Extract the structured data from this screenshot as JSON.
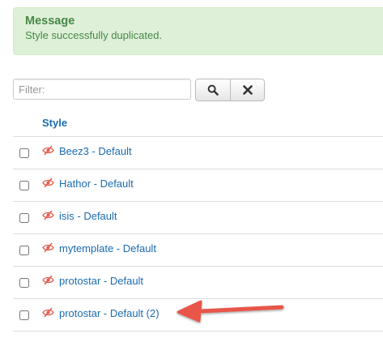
{
  "message": {
    "heading": "Message",
    "text": "Style successfully duplicated."
  },
  "filter": {
    "placeholder": "Filter:",
    "value": ""
  },
  "table": {
    "column_header": "Style",
    "rows": [
      {
        "label": "Beez3 - Default"
      },
      {
        "label": "Hathor - Default"
      },
      {
        "label": "isis - Default"
      },
      {
        "label": "mytemplate - Default"
      },
      {
        "label": "protostar - Default"
      },
      {
        "label": "protostar - Default (2)"
      }
    ]
  },
  "icons": {
    "search": "search-icon",
    "clear": "close-icon",
    "row_status": "eye-slash-icon",
    "annotation": "arrow-left-icon"
  },
  "colors": {
    "link": "#1a6bb0",
    "alert_bg": "#dff0d8",
    "alert_text": "#468847",
    "status_icon": "#e25b4d",
    "annotation_arrow": "#e8564a"
  }
}
